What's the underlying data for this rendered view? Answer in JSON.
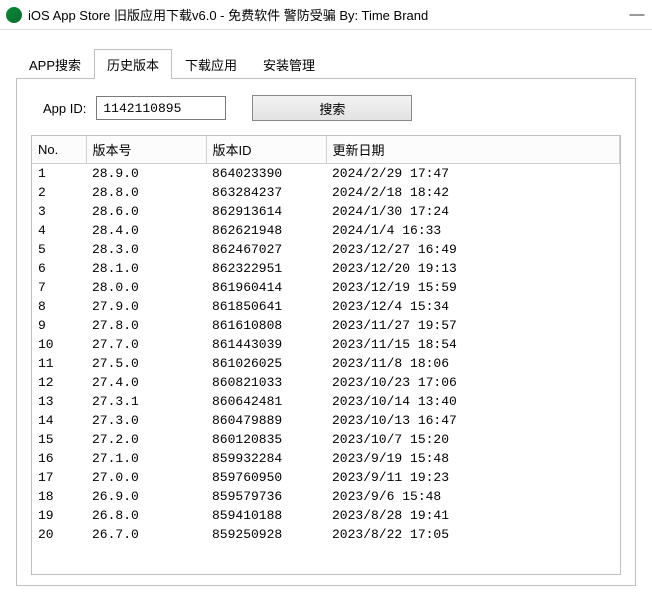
{
  "window": {
    "title": "iOS App Store 旧版应用下载v6.0 - 免费软件 警防受骗 By: Time Brand"
  },
  "tabs": [
    {
      "label": "APP搜索"
    },
    {
      "label": "历史版本"
    },
    {
      "label": "下载应用"
    },
    {
      "label": "安装管理"
    }
  ],
  "active_tab_index": 1,
  "search": {
    "label": "App ID:",
    "value": "1142110895",
    "button": "搜索"
  },
  "table": {
    "headers": [
      "No.",
      "版本号",
      "版本ID",
      "更新日期"
    ],
    "rows": [
      {
        "no": "1",
        "version": "28.9.0",
        "version_id": "864023390",
        "date": "2024/2/29 17:47"
      },
      {
        "no": "2",
        "version": "28.8.0",
        "version_id": "863284237",
        "date": "2024/2/18 18:42"
      },
      {
        "no": "3",
        "version": "28.6.0",
        "version_id": "862913614",
        "date": "2024/1/30 17:24"
      },
      {
        "no": "4",
        "version": "28.4.0",
        "version_id": "862621948",
        "date": "2024/1/4 16:33"
      },
      {
        "no": "5",
        "version": "28.3.0",
        "version_id": "862467027",
        "date": "2023/12/27 16:49"
      },
      {
        "no": "6",
        "version": "28.1.0",
        "version_id": "862322951",
        "date": "2023/12/20 19:13"
      },
      {
        "no": "7",
        "version": "28.0.0",
        "version_id": "861960414",
        "date": "2023/12/19 15:59"
      },
      {
        "no": "8",
        "version": "27.9.0",
        "version_id": "861850641",
        "date": "2023/12/4 15:34"
      },
      {
        "no": "9",
        "version": "27.8.0",
        "version_id": "861610808",
        "date": "2023/11/27 19:57"
      },
      {
        "no": "10",
        "version": "27.7.0",
        "version_id": "861443039",
        "date": "2023/11/15 18:54"
      },
      {
        "no": "11",
        "version": "27.5.0",
        "version_id": "861026025",
        "date": "2023/11/8 18:06"
      },
      {
        "no": "12",
        "version": "27.4.0",
        "version_id": "860821033",
        "date": "2023/10/23 17:06"
      },
      {
        "no": "13",
        "version": "27.3.1",
        "version_id": "860642481",
        "date": "2023/10/14 13:40"
      },
      {
        "no": "14",
        "version": "27.3.0",
        "version_id": "860479889",
        "date": "2023/10/13 16:47"
      },
      {
        "no": "15",
        "version": "27.2.0",
        "version_id": "860120835",
        "date": "2023/10/7 15:20"
      },
      {
        "no": "16",
        "version": "27.1.0",
        "version_id": "859932284",
        "date": "2023/9/19 15:48"
      },
      {
        "no": "17",
        "version": "27.0.0",
        "version_id": "859760950",
        "date": "2023/9/11 19:23"
      },
      {
        "no": "18",
        "version": "26.9.0",
        "version_id": "859579736",
        "date": "2023/9/6 15:48"
      },
      {
        "no": "19",
        "version": "26.8.0",
        "version_id": "859410188",
        "date": "2023/8/28 19:41"
      },
      {
        "no": "20",
        "version": "26.7.0",
        "version_id": "859250928",
        "date": "2023/8/22 17:05"
      }
    ]
  }
}
